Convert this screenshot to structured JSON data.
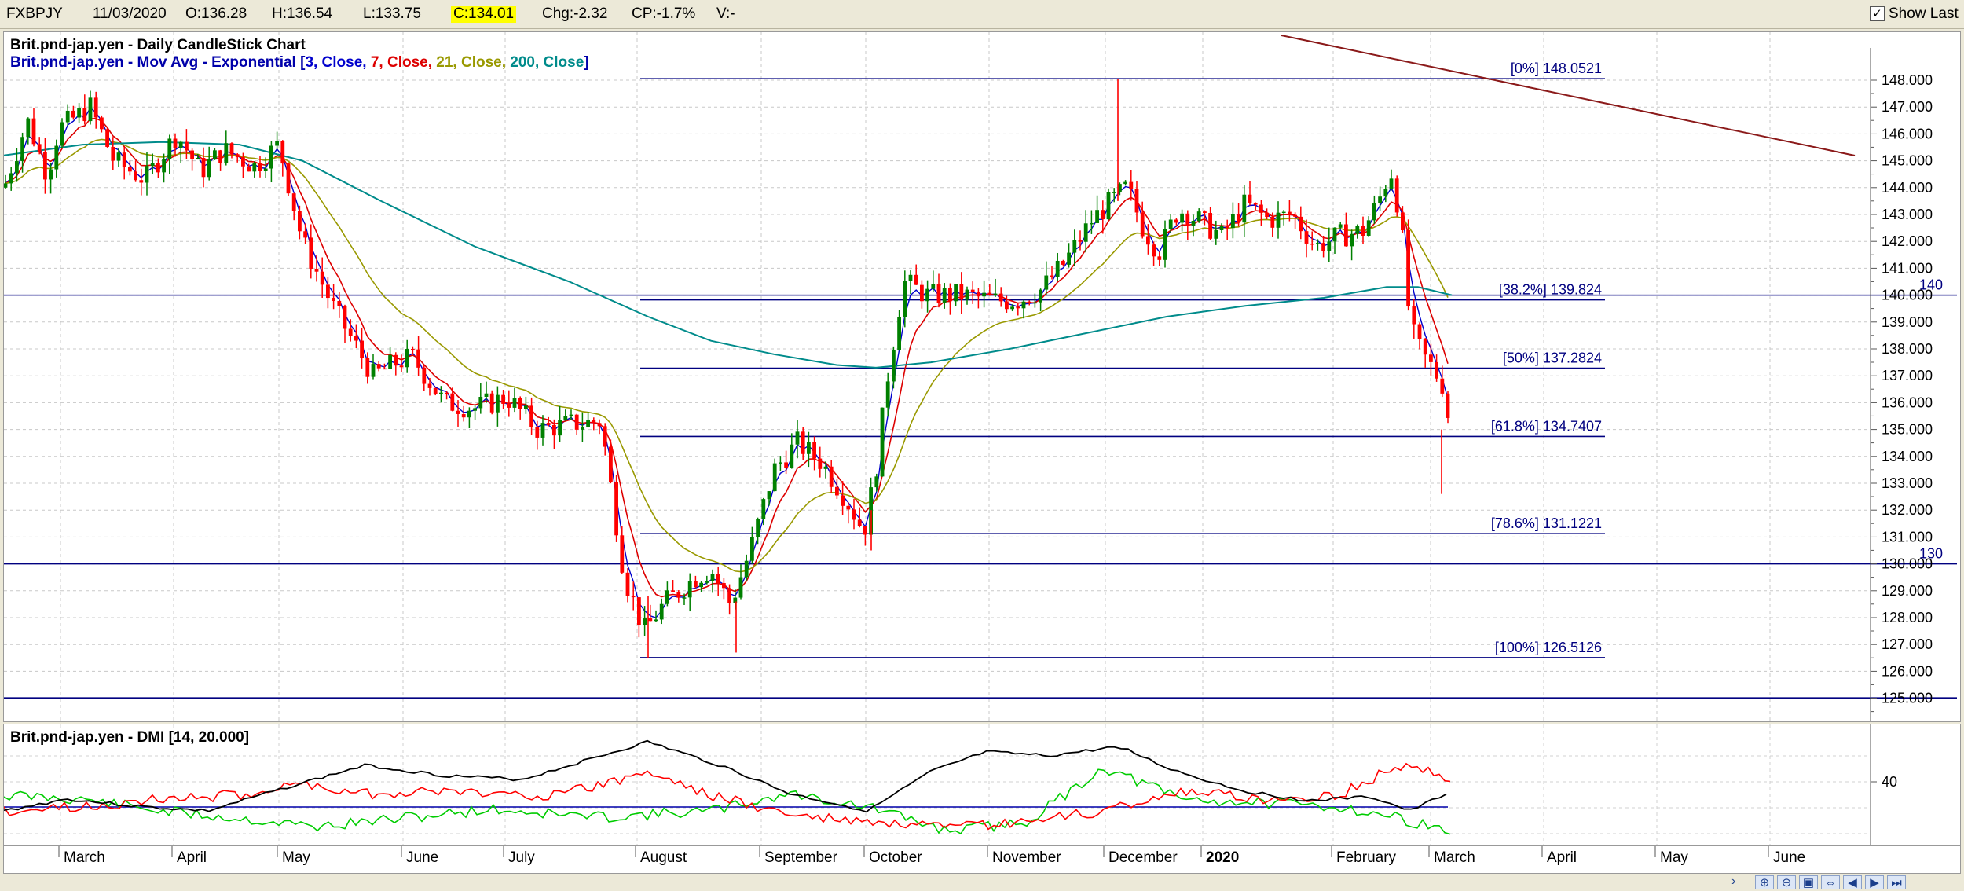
{
  "topbar": {
    "symbol": "FXBPJY",
    "date": "11/03/2020",
    "open": "O:136.28",
    "high": "H:136.54",
    "low": "L:133.75",
    "close": "C:134.01",
    "change": "Chg:-2.32",
    "change_pct": "CP:-1.7%",
    "volume": "V:-",
    "show_last_label": "Show Last",
    "show_last_checked": true
  },
  "main_chart": {
    "title": "Brit.pnd-jap.yen - Daily CandleStick Chart",
    "ma_legend": {
      "prefix": "Brit.pnd-jap.yen - Mov Avg - Exponential [",
      "items": [
        {
          "text": "3, Close,",
          "color": "#0000cc"
        },
        {
          "text": "7, Close,",
          "color": "#dd0000"
        },
        {
          "text": "21, Close,",
          "color": "#999900"
        },
        {
          "text": "200, Close",
          "color": "#008b8b"
        }
      ],
      "suffix": "]",
      "prefix_color": "#0000aa"
    },
    "fib_levels": [
      {
        "label": "[0%] 148.0521",
        "value": 148.0521
      },
      {
        "label": "[38.2%] 139.824",
        "value": 139.824
      },
      {
        "label": "[50%] 137.2824",
        "value": 137.2824
      },
      {
        "label": "[61.8%] 134.7407",
        "value": 134.7407
      },
      {
        "label": "[78.6%] 131.1221",
        "value": 131.1221
      },
      {
        "label": "[100%] 126.5126",
        "value": 126.5126
      }
    ],
    "horizontal_lines": [
      {
        "value": 140,
        "label": "140"
      },
      {
        "value": 130,
        "label": "130"
      },
      {
        "value": 125,
        "label": ""
      }
    ],
    "y_ticks": [
      "148.000",
      "147.000",
      "146.000",
      "145.000",
      "144.000",
      "143.000",
      "142.000",
      "141.000",
      "140.000",
      "139.000",
      "138.000",
      "137.000",
      "136.000",
      "135.000",
      "134.000",
      "133.000",
      "132.000",
      "131.000",
      "130.000",
      "129.000",
      "128.000",
      "127.000",
      "126.000",
      "125.000"
    ],
    "colors": {
      "up": "#008000",
      "down": "#ff0000",
      "fib": "#000080",
      "trendline": "#8b1a1a",
      "ema3": "#0000cc",
      "ema7": "#dd0000",
      "ema21": "#999900",
      "ema200": "#008b8b"
    }
  },
  "dmi": {
    "title": "Brit.pnd-jap.yen - DMI [14, 20.000]",
    "y_tick": "40",
    "colors": {
      "plus": "#00cc00",
      "minus": "#ff0000",
      "adx": "#000000",
      "threshold": "#0000aa"
    }
  },
  "x_axis": {
    "months": [
      "March",
      "April",
      "May",
      "June",
      "July",
      "August",
      "September",
      "October",
      "November",
      "December",
      "2020",
      "February",
      "March",
      "April",
      "May",
      "June"
    ]
  },
  "chart_data": {
    "type": "line",
    "title": "Brit.pnd-jap.yen - Daily CandleStick Chart",
    "xlabel": "",
    "ylabel": "",
    "x": [
      "March",
      "April",
      "May",
      "June",
      "July",
      "August",
      "September",
      "October",
      "November",
      "December",
      "2020",
      "February",
      "March"
    ],
    "series": [
      {
        "name": "Brit.pnd-jap.yen",
        "values": [
          144.5,
          145.8,
          144.5,
          138.0,
          136.0,
          127.5,
          130.0,
          131.5,
          140.0,
          141.0,
          142.5,
          143.5,
          134.0
        ]
      }
    ],
    "ylim": [
      124.5,
      148.6
    ],
    "grid": true
  }
}
